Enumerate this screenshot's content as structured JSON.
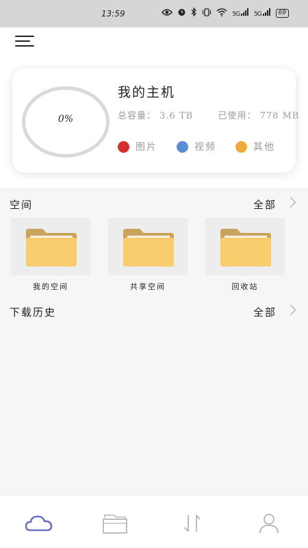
{
  "status": {
    "time": "13:59",
    "signal1": "5G",
    "signal2": "5G",
    "battery": "69"
  },
  "host": {
    "title": "我的主机",
    "progress": "0%",
    "total_label": "总容量：",
    "total_value": "3.6 TB",
    "used_label": "已使用：",
    "used_value": "778 MB",
    "legend": [
      {
        "label": "图片",
        "color": "#d32f2f"
      },
      {
        "label": "视频",
        "color": "#5b8dd6"
      },
      {
        "label": "其他",
        "color": "#efaa3c"
      }
    ]
  },
  "space": {
    "title": "空间",
    "all_label": "全部",
    "folders": [
      {
        "label": "我的空间"
      },
      {
        "label": "共享空间"
      },
      {
        "label": "回收站"
      }
    ]
  },
  "history": {
    "title": "下载历史",
    "all_label": "全部"
  },
  "colors": {
    "folder_body": "#f7cd6e",
    "folder_back": "#c9a45c",
    "tab_active": "#6b6fc4",
    "tab_inactive": "#b5b5b5"
  }
}
